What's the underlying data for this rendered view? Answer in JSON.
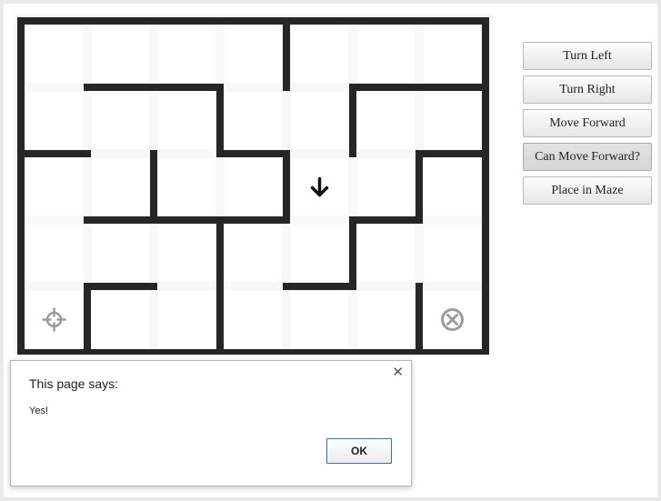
{
  "maze": {
    "cols": 7,
    "rows": 5,
    "h_walls": [
      [
        1,
        1,
        1,
        1,
        1,
        1,
        1
      ],
      [
        0,
        1,
        1,
        0,
        0,
        1,
        1
      ],
      [
        1,
        0,
        0,
        1,
        0,
        0,
        1
      ],
      [
        0,
        1,
        1,
        1,
        0,
        1,
        0
      ],
      [
        0,
        1,
        0,
        0,
        1,
        0,
        0
      ],
      [
        1,
        1,
        1,
        1,
        1,
        1,
        1
      ]
    ],
    "v_walls": [
      [
        1,
        0,
        0,
        0,
        1,
        0,
        0,
        1
      ],
      [
        1,
        0,
        0,
        1,
        0,
        1,
        0,
        1
      ],
      [
        1,
        0,
        1,
        0,
        1,
        0,
        1,
        1
      ],
      [
        1,
        0,
        0,
        1,
        0,
        1,
        0,
        1
      ],
      [
        1,
        1,
        0,
        1,
        0,
        0,
        1,
        1
      ]
    ],
    "robot": {
      "col": 4,
      "row": 2,
      "direction": "down",
      "icon": "arrow-down-icon"
    },
    "start": {
      "col": 0,
      "row": 4,
      "icon": "crosshair-icon"
    },
    "goal": {
      "col": 6,
      "row": 4,
      "icon": "circle-x-icon"
    },
    "colors": {
      "wall": "#262626",
      "floor": "#f8f8f8",
      "cell": "#ffffff",
      "marker": "#9c9c9c",
      "robot": "#111111"
    }
  },
  "controls": {
    "turn_left": "Turn Left",
    "turn_right": "Turn Right",
    "move_forward": "Move Forward",
    "can_move_forward": "Can Move Forward?",
    "place_in_maze": "Place in Maze"
  },
  "dialog": {
    "title": "This page says:",
    "message": "Yes!",
    "ok_label": "OK",
    "close_icon": "close-icon"
  }
}
